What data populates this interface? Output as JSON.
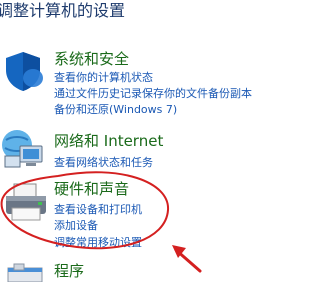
{
  "page_title": "调整计算机的设置",
  "categories": [
    {
      "title": "系统和安全",
      "links": [
        "查看你的计算机状态",
        "通过文件历史记录保存你的文件备份副本",
        "备份和还原(Windows 7)"
      ]
    },
    {
      "title": "网络和 Internet",
      "links": [
        "查看网络状态和任务"
      ]
    },
    {
      "title": "硬件和声音",
      "links": [
        "查看设备和打印机",
        "添加设备",
        "调整常用移动设置"
      ]
    },
    {
      "title": "程序",
      "links": []
    }
  ],
  "colors": {
    "title": "#1e3b6d",
    "category_title": "#1a6a1a",
    "link": "#1a58b4",
    "annotation": "#d42020"
  }
}
